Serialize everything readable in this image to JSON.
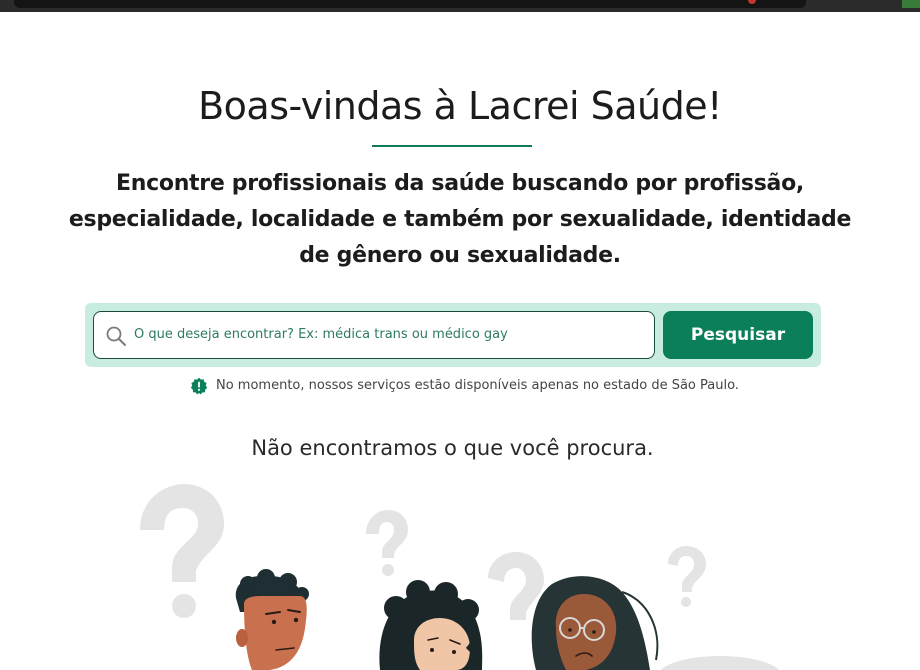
{
  "page": {
    "title": "Boas-vindas à Lacrei Saúde!",
    "subtitle": "Encontre profissionais da saúde buscando por profissão, especialidade, localidade e também por sexualidade, identidade de gênero ou sexualidade."
  },
  "search": {
    "placeholder": "O que deseja encontrar? Ex: médica trans ou médico gay",
    "button_label": "Pesquisar",
    "icon": "search-icon"
  },
  "notice": {
    "text": "No momento, nossos serviços estão disponíveis apenas no estado de São Paulo.",
    "icon": "alert-badge-icon"
  },
  "results": {
    "empty_message": "Não encontramos o que você procura."
  },
  "colors": {
    "brand_green": "#0b7f5a",
    "panel_green": "#c9ece0",
    "underline_green": "#0f7b59",
    "question_mark_gray": "#e4e4e4"
  }
}
